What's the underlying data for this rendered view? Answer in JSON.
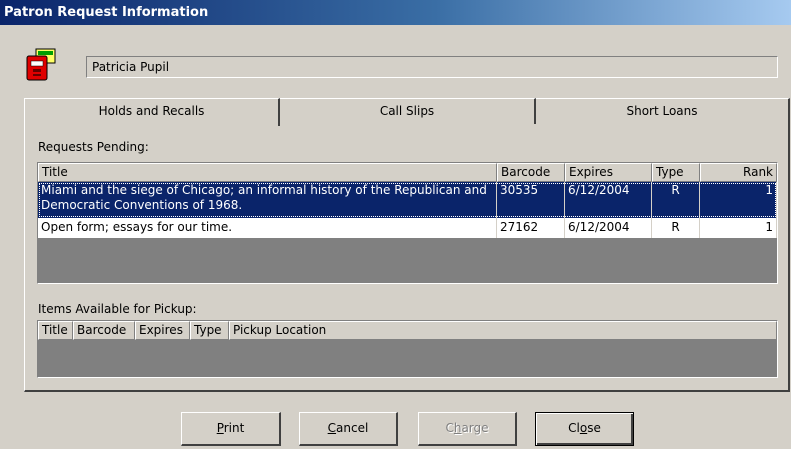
{
  "window": {
    "title": "Patron Request Information"
  },
  "patron": {
    "name": "Patricia Pupil",
    "icon": "patron-card-icon"
  },
  "tabs": [
    {
      "label": "Holds and Recalls",
      "active": true
    },
    {
      "label": "Call Slips",
      "active": false
    },
    {
      "label": "Short Loans",
      "active": false
    }
  ],
  "requests_pending": {
    "label": "Requests Pending:",
    "columns": [
      "Title",
      "Barcode",
      "Expires",
      "Type",
      "Rank"
    ],
    "rows": [
      {
        "title": "Miami and the siege of Chicago; an informal history of the Republican and Democratic Conventions of 1968.",
        "barcode": "30535",
        "expires": "6/12/2004",
        "type": "R",
        "rank": "1",
        "selected": true
      },
      {
        "title": "Open form; essays for our time.",
        "barcode": "27162",
        "expires": "6/12/2004",
        "type": "R",
        "rank": "1",
        "selected": false
      }
    ]
  },
  "items_available": {
    "label": "Items Available for Pickup:",
    "columns": [
      "Title",
      "Barcode",
      "Expires",
      "Type",
      "Pickup Location"
    ],
    "rows": []
  },
  "buttons": {
    "print": {
      "pre": "",
      "mnemonic": "P",
      "post": "rint"
    },
    "cancel": {
      "pre": "",
      "mnemonic": "C",
      "post": "ancel"
    },
    "charge": {
      "pre": "C",
      "mnemonic": "h",
      "post": "arge",
      "disabled": true
    },
    "close": {
      "pre": "Cl",
      "mnemonic": "o",
      "post": "se"
    }
  },
  "colors": {
    "title_bar": "#0a246a",
    "selection": "#0a246a",
    "grid_background": "#808080",
    "window_face": "#d4d0c8"
  }
}
